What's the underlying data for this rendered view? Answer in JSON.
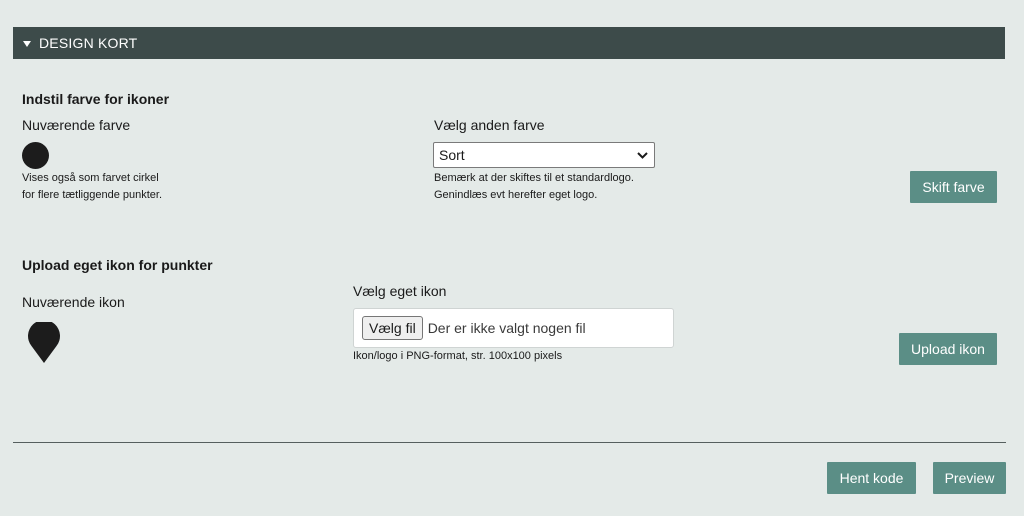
{
  "header": {
    "title": "DESIGN KORT",
    "icon": "caret-down-icon"
  },
  "color_section": {
    "title": "Indstil farve for ikoner",
    "current_label": "Nuværende farve",
    "current_color": "#1c1c1c",
    "current_note_line1": "Vises også som farvet cirkel",
    "current_note_line2": "for flere tætliggende punkter.",
    "choose_label": "Vælg anden farve",
    "select_value": "Sort",
    "choose_note_line1": "Bemærk at der skiftes til et standardlogo.",
    "choose_note_line2": "Genindlæs evt herefter eget logo.",
    "apply_button": "Skift farve"
  },
  "icon_section": {
    "title": "Upload eget ikon for punkter",
    "current_label": "Nuværende ikon",
    "current_icon": "map-pin-icon",
    "choose_label": "Vælg eget ikon",
    "file_button": "Vælg fil",
    "file_status": "Der er ikke valgt nogen fil",
    "file_note": "Ikon/logo i PNG-format, str. 100x100 pixels",
    "upload_button": "Upload ikon"
  },
  "footer": {
    "get_code_button": "Hent kode",
    "preview_button": "Preview"
  },
  "colors": {
    "header_bg": "#3d4b4a",
    "button_bg": "#5b8e86",
    "page_bg": "#e4eae8"
  }
}
